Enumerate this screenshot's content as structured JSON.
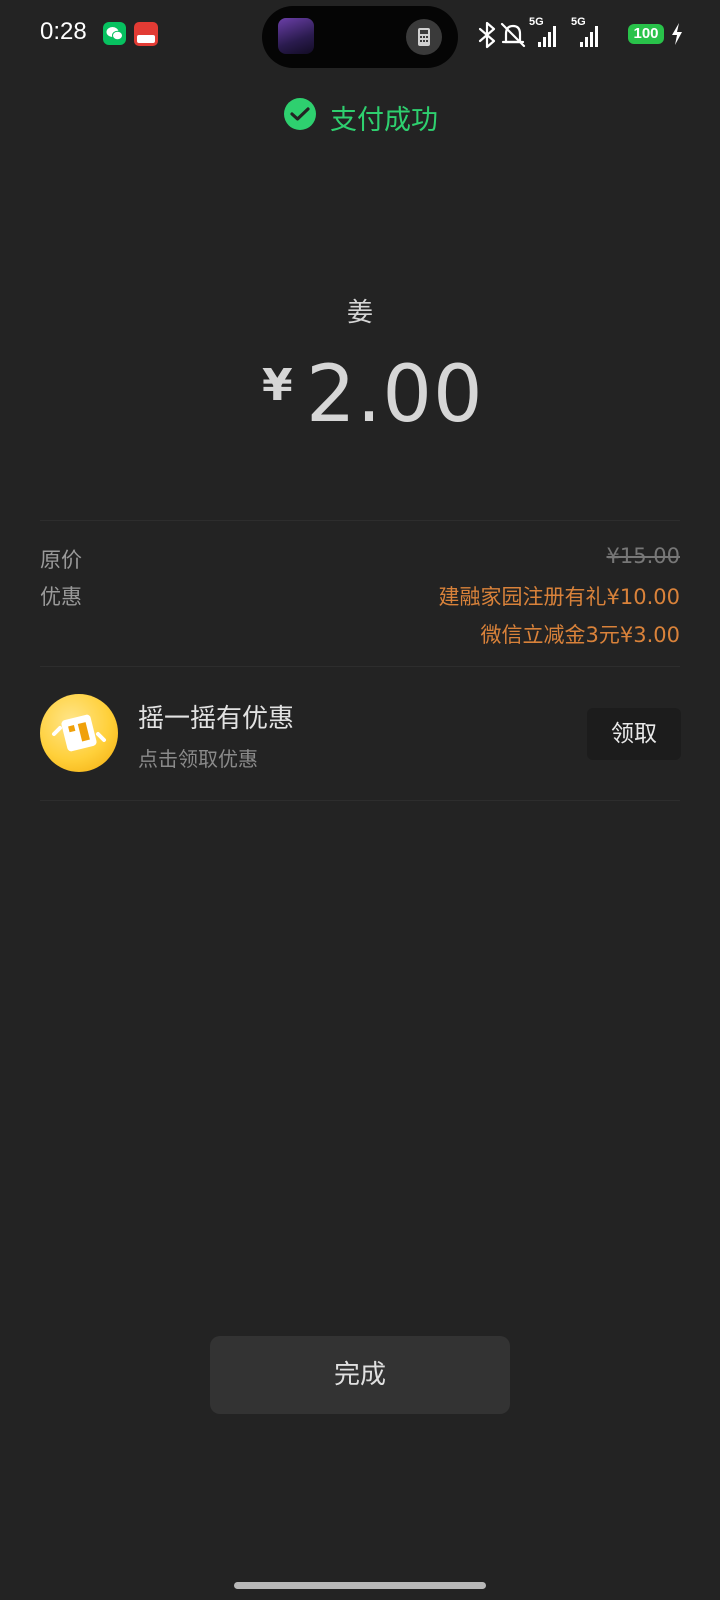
{
  "status_bar": {
    "time": "0:28",
    "network_label_1": "5G",
    "network_label_2": "5G",
    "battery": "100",
    "icons": [
      "wechat-app-icon",
      "red-app-icon",
      "bluetooth-icon",
      "mute-icon",
      "signal-icon",
      "battery-icon",
      "charging-icon"
    ]
  },
  "header": {
    "status": "支付成功",
    "accent_color": "#2ed06f"
  },
  "payment": {
    "payee": "姜",
    "currency_symbol": "¥",
    "amount": "2.00"
  },
  "details": {
    "original_label": "原价",
    "original_price": "¥15.00",
    "discount_label": "优惠",
    "discounts": [
      "建融家园注册有礼¥10.00",
      "微信立减金3元¥3.00"
    ],
    "discount_color": "#d9823a"
  },
  "promo": {
    "title": "摇一摇有优惠",
    "subtitle": "点击领取优惠",
    "button_label": "领取"
  },
  "footer": {
    "done_label": "完成"
  }
}
